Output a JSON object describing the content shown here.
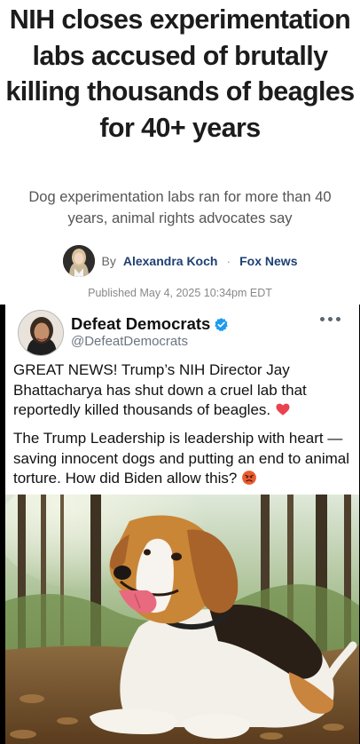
{
  "article": {
    "headline": "NIH closes experimentation labs accused of brutally killing thousands of beagles for 40+ years",
    "subhead": "Dog experimentation labs ran for more than 40 years, animal rights advocates say",
    "byline_prefix": "By",
    "author": "Alexandra Koch",
    "separator": "·",
    "outlet": "Fox News",
    "published": "Published May 4, 2025 10:34pm EDT"
  },
  "tweet": {
    "display_name": "Defeat Democrats",
    "handle": "@DefeatDemocrats",
    "verified_icon": "verified-badge-icon",
    "paragraph1": "GREAT NEWS! Trump’s NIH Director Jay Bhattacharya has shut down a cruel lab that reportedly killed thousands of beagles.",
    "paragraph1_emoji": "red-heart-emoji",
    "paragraph2": "The Trump Leadership is leadership with heart — saving innocent dogs and putting an end to animal torture. How did Biden allow this?",
    "paragraph2_emoji": "angry-face-emoji",
    "photo": "beagle-lying-in-forest-leaves",
    "colors": {
      "verified": "#1d9bf0",
      "heart": "#e0245e",
      "angry": "#e8552a"
    }
  }
}
